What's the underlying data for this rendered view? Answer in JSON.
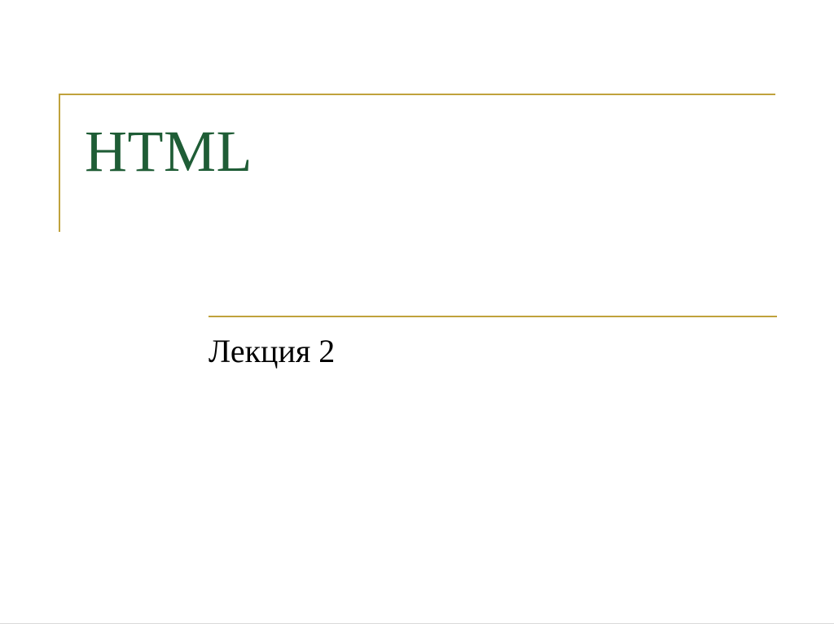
{
  "slide": {
    "title": "HTML",
    "subtitle": "Лекция 2",
    "accent_color": "#c0a23c",
    "title_color": "#1f5d36"
  }
}
